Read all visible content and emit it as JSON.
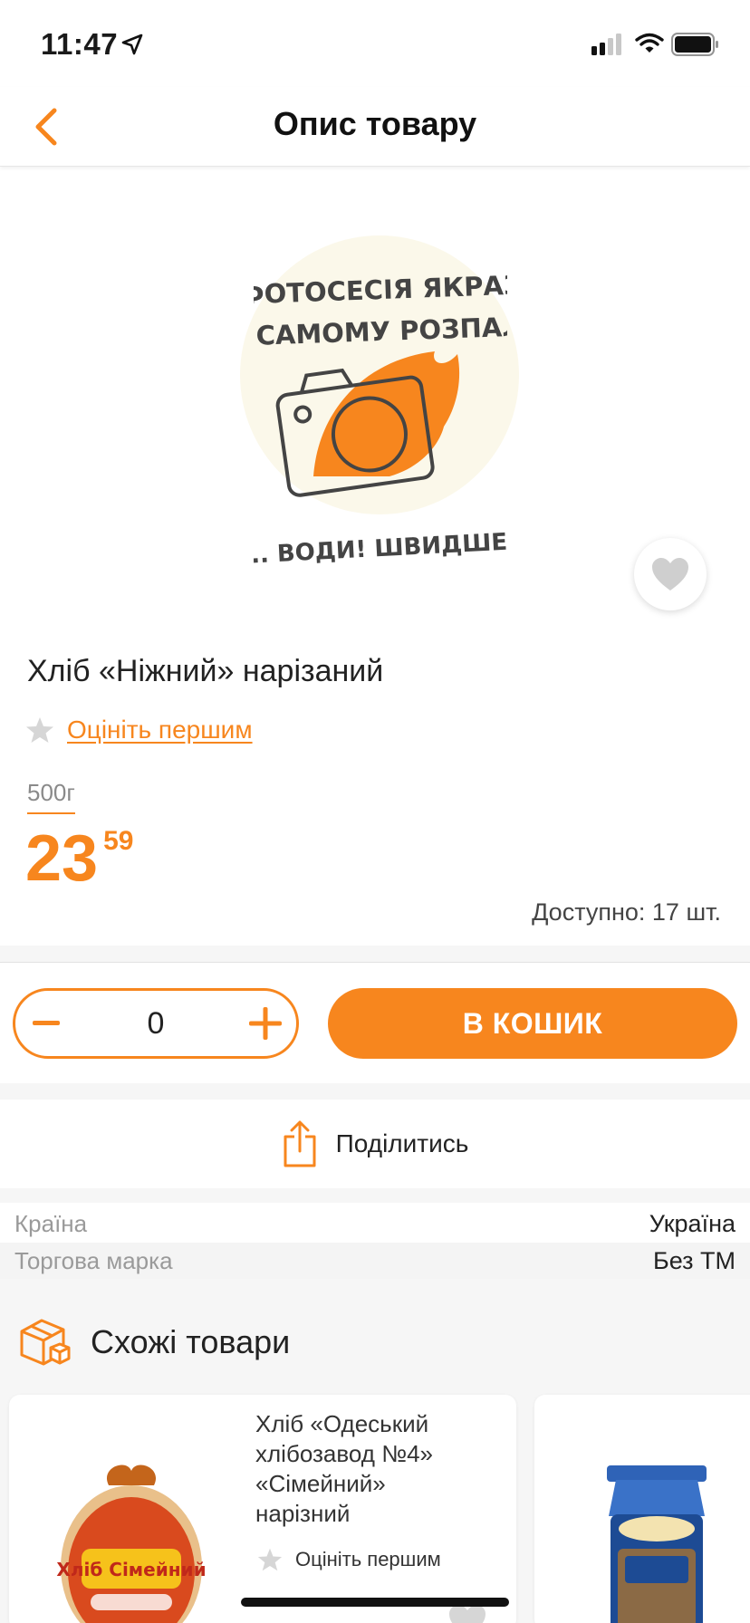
{
  "status_bar": {
    "time": "11:47"
  },
  "nav": {
    "title": "Опис товару",
    "back_icon": "chevron-left-icon"
  },
  "product": {
    "image_placeholder": {
      "line1": "ФОТОСЕСІЯ ЯКРАЗ",
      "line2": "У САМОМУ РОЗПАЛІ",
      "line3": "... ВОДИ! ШВИДШЕ!"
    },
    "name": "Хліб «Ніжний» нарізаний",
    "rating_link": "Оцініть першим",
    "weight": "500г",
    "price_main": "23",
    "price_cents": "59",
    "availability": "Доступно: 17 шт."
  },
  "buy": {
    "quantity": "0",
    "add_to_cart": "В КОШИК"
  },
  "share": {
    "label": "Поділитись"
  },
  "attributes": [
    {
      "key": "Країна",
      "value": "Україна"
    },
    {
      "key": "Торгова марка",
      "value": "Без ТМ"
    }
  ],
  "similar": {
    "title": "Схожі товари",
    "items": [
      {
        "name_lines": [
          "Хліб «Одеський",
          "хлібозавод №4»",
          "«Сімейний»",
          "нарізний"
        ],
        "rating": "Оцініть першим",
        "package_text": "Хліб Сімейний"
      },
      {
        "name_lines": [],
        "rating": "",
        "package_text": ""
      }
    ]
  },
  "colors": {
    "accent": "#f7861e",
    "text": "#1a1a1a",
    "muted": "#9a9a9a",
    "background_gray": "#f6f6f6"
  }
}
